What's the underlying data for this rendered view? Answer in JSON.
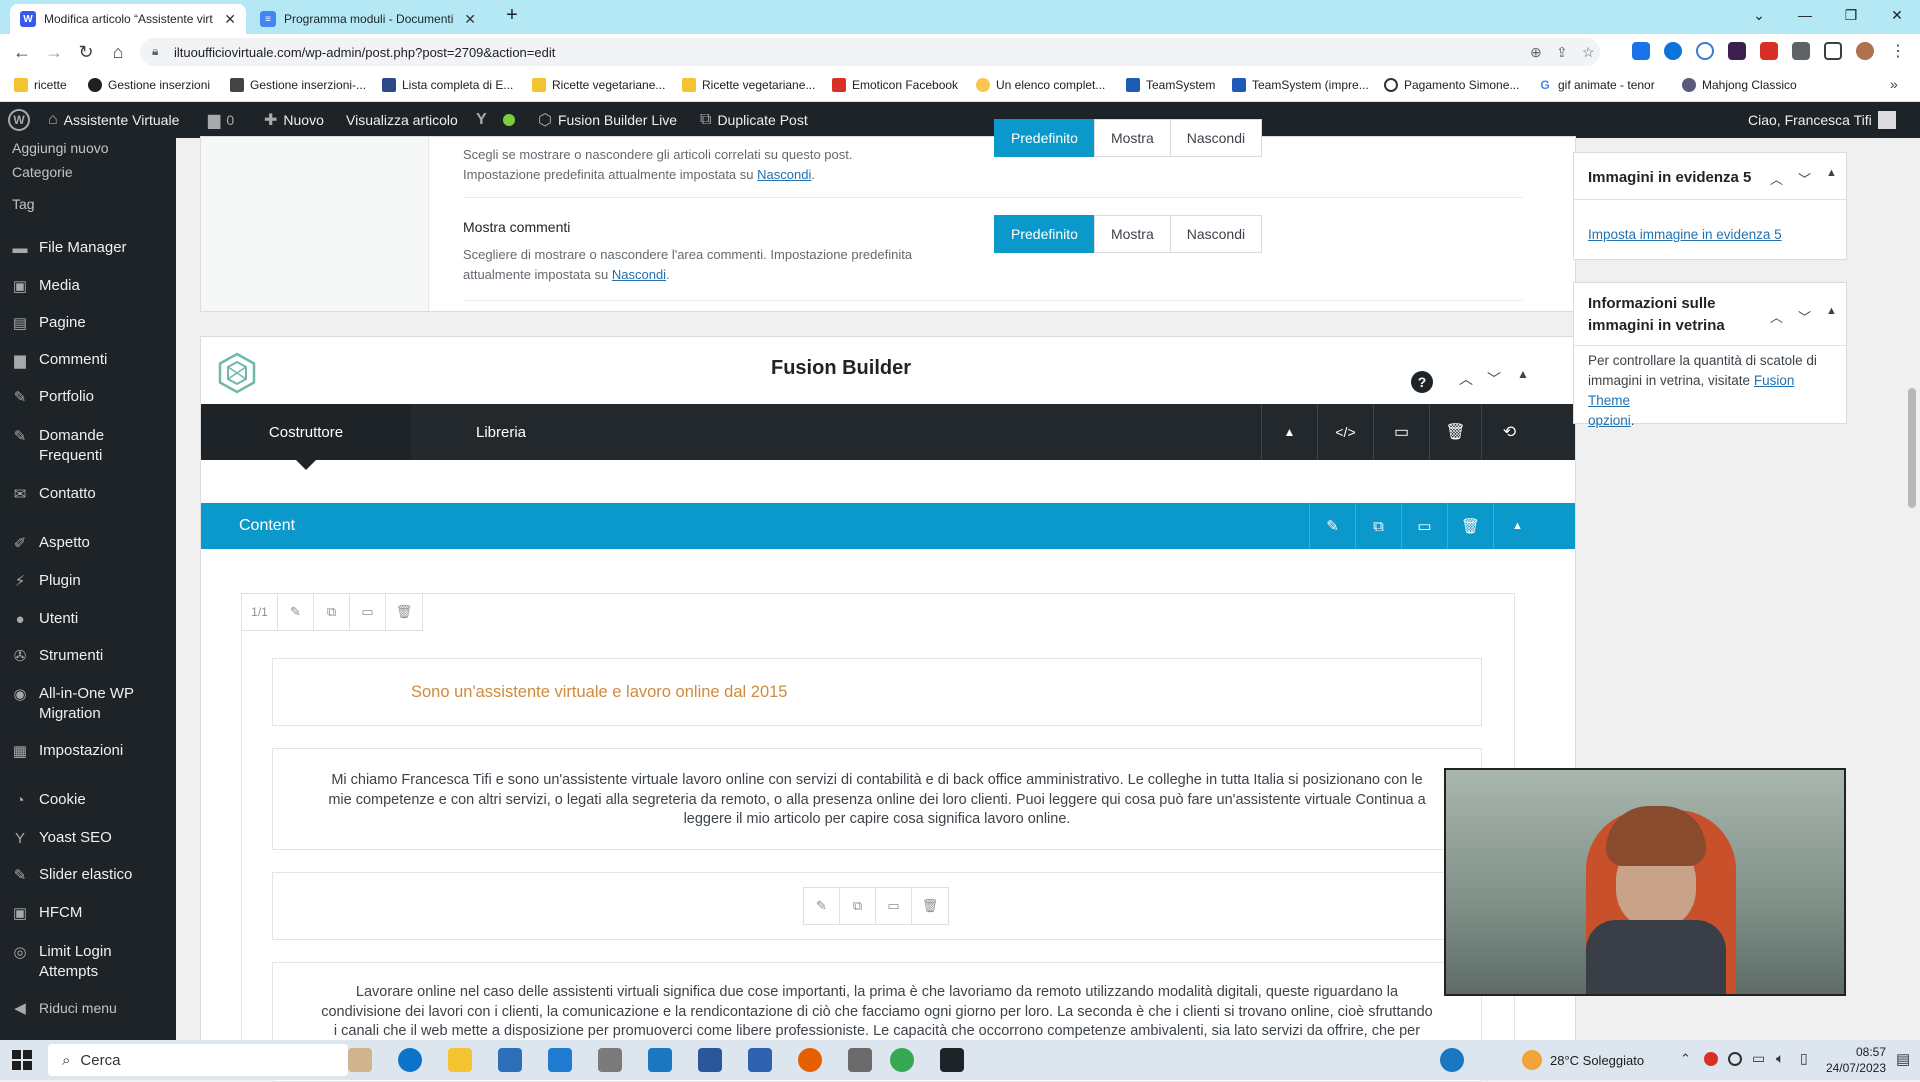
{
  "browser": {
    "tabs": [
      {
        "title": "Modifica articolo “Assistente virt",
        "active": true
      },
      {
        "title": "Programma moduli - Documenti",
        "active": false
      }
    ],
    "new_tab": "+",
    "url": "iltuoufficiovirtuale.com/wp-admin/post.php?post=2709&action=edit",
    "bookmarks": [
      "ricette",
      "Gestione inserzioni",
      "Gestione inserzioni-...",
      "Lista completa di E...",
      "Ricette vegetariane...",
      "Ricette vegetariane...",
      "Emoticon Facebook",
      "Un elenco complet...",
      "TeamSystem",
      "TeamSystem (impre...",
      "Pagamento Simone...",
      "gif animate - tenor",
      "Mahjong Classico"
    ]
  },
  "adminbar": {
    "site": "Assistente Virtuale",
    "comments": "0",
    "new": "Nuovo",
    "view": "Visualizza articolo",
    "fusion_live": "Fusion Builder Live",
    "duplicate": "Duplicate Post",
    "greeting": "Ciao, Francesca Tifi"
  },
  "sidebar": {
    "submenu": [
      "Aggiungi nuovo",
      "Categorie",
      "Tag"
    ],
    "items": [
      {
        "label": "File Manager",
        "icon": "folder-icon"
      },
      {
        "label": "Media",
        "icon": "media-icon"
      },
      {
        "label": "Pagine",
        "icon": "page-icon"
      },
      {
        "label": "Commenti",
        "icon": "comment-icon"
      },
      {
        "label": "Portfolio",
        "icon": "pin-icon"
      },
      {
        "label": "Domande",
        "label2": "Frequenti",
        "icon": "pin-icon"
      },
      {
        "label": "Contatto",
        "icon": "mail-icon"
      },
      {
        "label": "Aspetto",
        "icon": "brush-icon"
      },
      {
        "label": "Plugin",
        "icon": "plugin-icon"
      },
      {
        "label": "Utenti",
        "icon": "user-icon"
      },
      {
        "label": "Strumenti",
        "icon": "wrench-icon"
      },
      {
        "label": "All-in-One WP",
        "label2": "Migration",
        "icon": "migration-icon"
      },
      {
        "label": "Impostazioni",
        "icon": "settings-icon"
      },
      {
        "label": "Cookie",
        "icon": "cookie-icon"
      },
      {
        "label": "Yoast SEO",
        "icon": "yoast-icon"
      },
      {
        "label": "Slider elastico",
        "icon": "pin-icon"
      },
      {
        "label": "HFCM",
        "icon": "hfcm-icon"
      },
      {
        "label": "Limit Login",
        "label2": "Attempts",
        "icon": "lock-icon"
      },
      {
        "label": "Riduci menu",
        "icon": "collapse-icon"
      }
    ]
  },
  "options": {
    "related": {
      "desc1": "Scegli se mostrare o nascondere gli articoli correlati su questo post.",
      "desc2": "Impostazione predefinita attualmente impostata su",
      "link": "Nascondi",
      "buttons": [
        "Predefinito",
        "Mostra",
        "Nascondi"
      ]
    },
    "comments": {
      "label": "Mostra commenti",
      "desc1": "Scegliere di mostrare o nascondere l'area commenti. Impostazione predefinita",
      "desc2": "attualmente impostata su",
      "link": "Nascondi",
      "buttons": [
        "Predefinito",
        "Mostra",
        "Nascondi"
      ]
    }
  },
  "fusion": {
    "title": "Fusion Builder",
    "help": "?",
    "tabs": [
      "Costruttore",
      "Libreria"
    ],
    "container_label": "Content",
    "column_size": "1/1",
    "heading": "Sono un'assistente virtuale e lavoro online dal 2015",
    "para1": [
      "Mi chiamo Francesca Tifi e sono un'assistente virtuale lavoro online con servizi di contabilità e di back office amministrativo. Le colleghe in tutta Italia si posizionano con le",
      "mie competenze e con altri servizi, o legati alla segreteria da remoto, o alla presenza online dei loro clienti. Puoi leggere qui cosa può fare un'assistente virtuale Continua a",
      "leggere il mio articolo per capire cosa significa lavoro online."
    ],
    "para2": [
      "Lavorare online nel caso delle assistenti virtuali significa due cose importanti, la prima è che lavoriamo da remoto utilizzando modalità digitali, queste riguardano la",
      "condivisione dei lavori con i clienti, la comunicazione e la rendicontazione di ciò che facciamo ogni giorno per loro. La seconda è che i clienti si trovano online, cioè sfruttando",
      "i canali che il web mette a disposizione per promuoverci come libere professioniste. Le capacità che occorrono competenze ambivalenti, sia lato servizi da offrire, che per"
    ]
  },
  "metaboxes": {
    "featured5": {
      "title": "Immagini in evidenza 5",
      "link": "Imposta immagine in evidenza 5"
    },
    "showcase": {
      "title1": "Informazioni sulle",
      "title2": "immagini in vetrina",
      "text1": "Per controllare la quantità di scatole di",
      "text2": "immagini in vetrina, visitate",
      "link1": "Fusion Theme",
      "link2": "opzioni",
      "text3": "."
    }
  },
  "taskbar": {
    "search": "Cerca",
    "weather": "28°C  Soleggiato",
    "time": "08:57",
    "date": "24/07/2023"
  },
  "colors": {
    "wp_dark": "#1d2327",
    "fusion_blue": "#0b99cc",
    "heading_orange": "#d08a3c",
    "tab_strip": "#b5e8f5"
  }
}
